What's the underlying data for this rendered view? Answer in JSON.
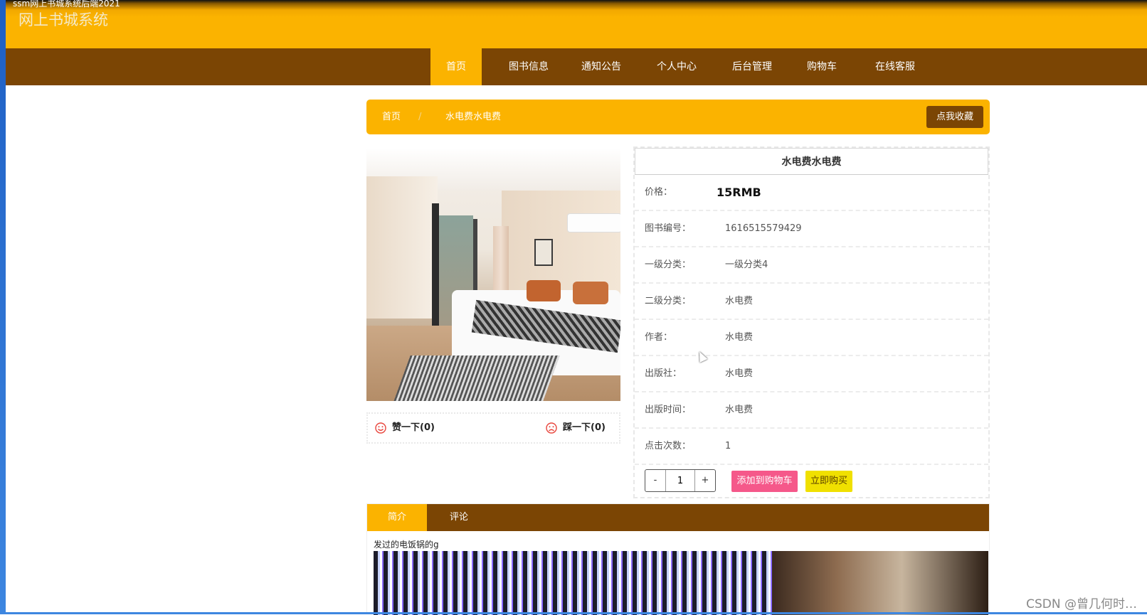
{
  "window": {
    "title": "ssm网上书城系统后端2021"
  },
  "header": {
    "site_title": "网上书城系统"
  },
  "nav": {
    "items": [
      {
        "label": "首页",
        "active": true
      },
      {
        "label": "图书信息"
      },
      {
        "label": "通知公告"
      },
      {
        "label": "个人中心"
      },
      {
        "label": "后台管理"
      },
      {
        "label": "购物车"
      },
      {
        "label": "在线客服"
      }
    ]
  },
  "breadcrumb": {
    "home": "首页",
    "separator": "/",
    "current": "水电费水电费",
    "collect_label": "点我收藏"
  },
  "votes": {
    "like_label": "赞一下(0)",
    "dislike_label": "踩一下(0)"
  },
  "detail": {
    "title": "水电费水电费",
    "rows": [
      {
        "label": "价格：",
        "value": "15RMB"
      },
      {
        "label": "图书编号：",
        "value": "1616515579429"
      },
      {
        "label": "一级分类：",
        "value": "一级分类4"
      },
      {
        "label": "二级分类：",
        "value": "水电费"
      },
      {
        "label": "作者：",
        "value": "水电费"
      },
      {
        "label": "出版社：",
        "value": "水电费"
      },
      {
        "label": "出版时间：",
        "value": "水电费"
      },
      {
        "label": "点击次数：",
        "value": "1"
      }
    ],
    "quantity": {
      "minus": "-",
      "value": "1",
      "plus": "+"
    },
    "add_cart_label": "添加到购物车",
    "buy_label": "立即购买"
  },
  "tabs": {
    "items": [
      {
        "label": "简介",
        "active": true
      },
      {
        "label": "评论"
      }
    ],
    "intro_text": "发过的电饭锅的g"
  },
  "watermark": "CSDN @曾几何时…",
  "colors": {
    "primary_yellow": "#fbb300",
    "nav_brown": "#7b4504",
    "add_cart_pink": "#f5588a",
    "buy_yellow": "#f0e000",
    "smiley_red": "#e8453c"
  },
  "icons": {
    "like": "smiley-icon",
    "dislike": "sad-face-icon"
  }
}
